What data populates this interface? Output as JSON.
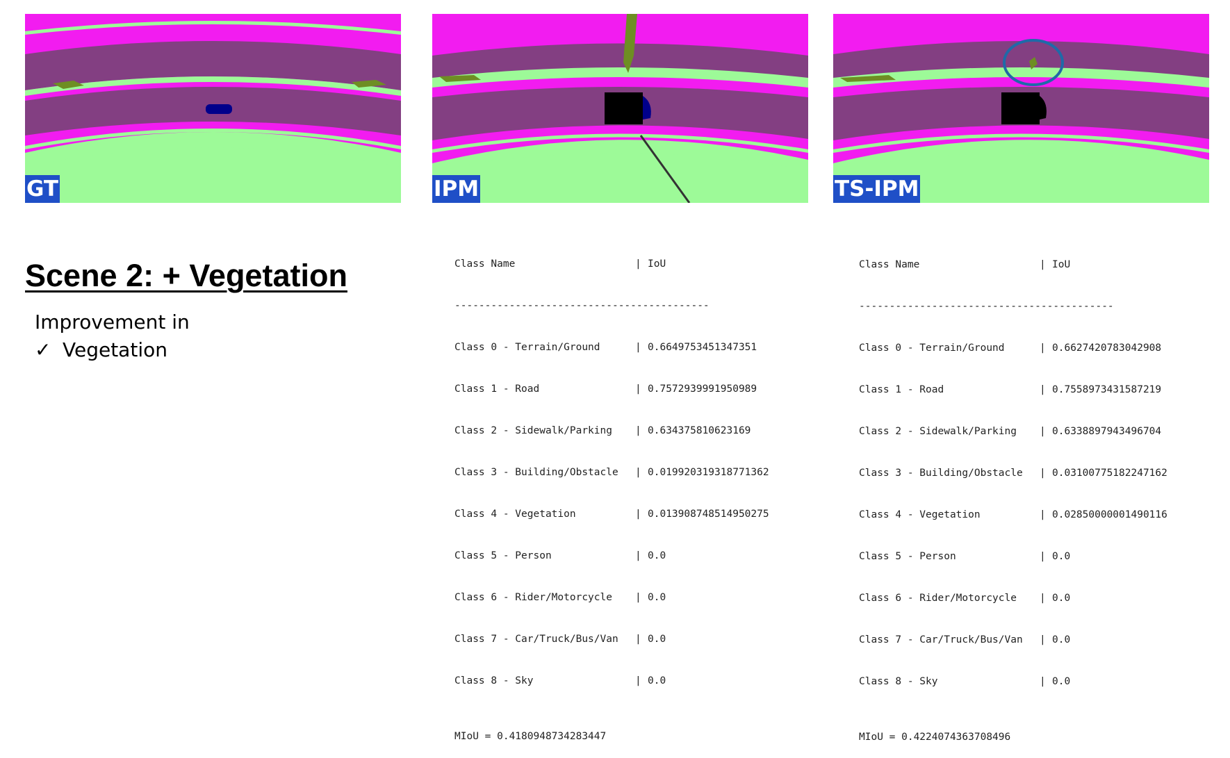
{
  "panels": [
    {
      "label": "GT"
    },
    {
      "label": "IPM"
    },
    {
      "label": "TS-IPM"
    }
  ],
  "scene": {
    "title": "Scene 2: + Vegetation",
    "improvement_heading": "Improvement in",
    "check_glyph": "✓",
    "improved_item": "Vegetation"
  },
  "colors": {
    "road": "#833f82",
    "sidewalk": "#f21cf0",
    "terrain": "#9dfa98",
    "vegetation": "#6e8e23",
    "car": "#00008b",
    "obstacle": "#000000",
    "label_bg": "#1f4fc7",
    "highlight_circle": "#1f6aa8"
  },
  "metrics": {
    "header_class": "Class Name",
    "header_iou": "IoU",
    "divider": "------------------------------------------",
    "ipm": {
      "rows": [
        {
          "cls": "Class 0 - Terrain/Ground",
          "iou": "0.6649753451347351"
        },
        {
          "cls": "Class 1 - Road",
          "iou": "0.7572939991950989"
        },
        {
          "cls": "Class 2 - Sidewalk/Parking",
          "iou": "0.634375810623169"
        },
        {
          "cls": "Class 3 - Building/Obstacle",
          "iou": "0.019920319318771362"
        },
        {
          "cls": "Class 4 - Vegetation",
          "iou": "0.013908748514950275"
        },
        {
          "cls": "Class 5 - Person",
          "iou": "0.0"
        },
        {
          "cls": "Class 6 - Rider/Motorcycle",
          "iou": "0.0"
        },
        {
          "cls": "Class 7 - Car/Truck/Bus/Van",
          "iou": "0.0"
        },
        {
          "cls": "Class 8 - Sky",
          "iou": "0.0"
        }
      ],
      "miou": "MIoU = 0.4180948734283447"
    },
    "tsipm": {
      "rows": [
        {
          "cls": "Class 0 - Terrain/Ground",
          "iou": "0.6627420783042908"
        },
        {
          "cls": "Class 1 - Road",
          "iou": "0.7558973431587219"
        },
        {
          "cls": "Class 2 - Sidewalk/Parking",
          "iou": "0.6338897943496704"
        },
        {
          "cls": "Class 3 - Building/Obstacle",
          "iou": "0.03100775182247162"
        },
        {
          "cls": "Class 4 - Vegetation",
          "iou": "0.02850000001490116"
        },
        {
          "cls": "Class 5 - Person",
          "iou": "0.0"
        },
        {
          "cls": "Class 6 - Rider/Motorcycle",
          "iou": "0.0"
        },
        {
          "cls": "Class 7 - Car/Truck/Bus/Van",
          "iou": "0.0"
        },
        {
          "cls": "Class 8 - Sky",
          "iou": "0.0"
        }
      ],
      "miou": "MIoU = 0.4224074363708496"
    }
  }
}
